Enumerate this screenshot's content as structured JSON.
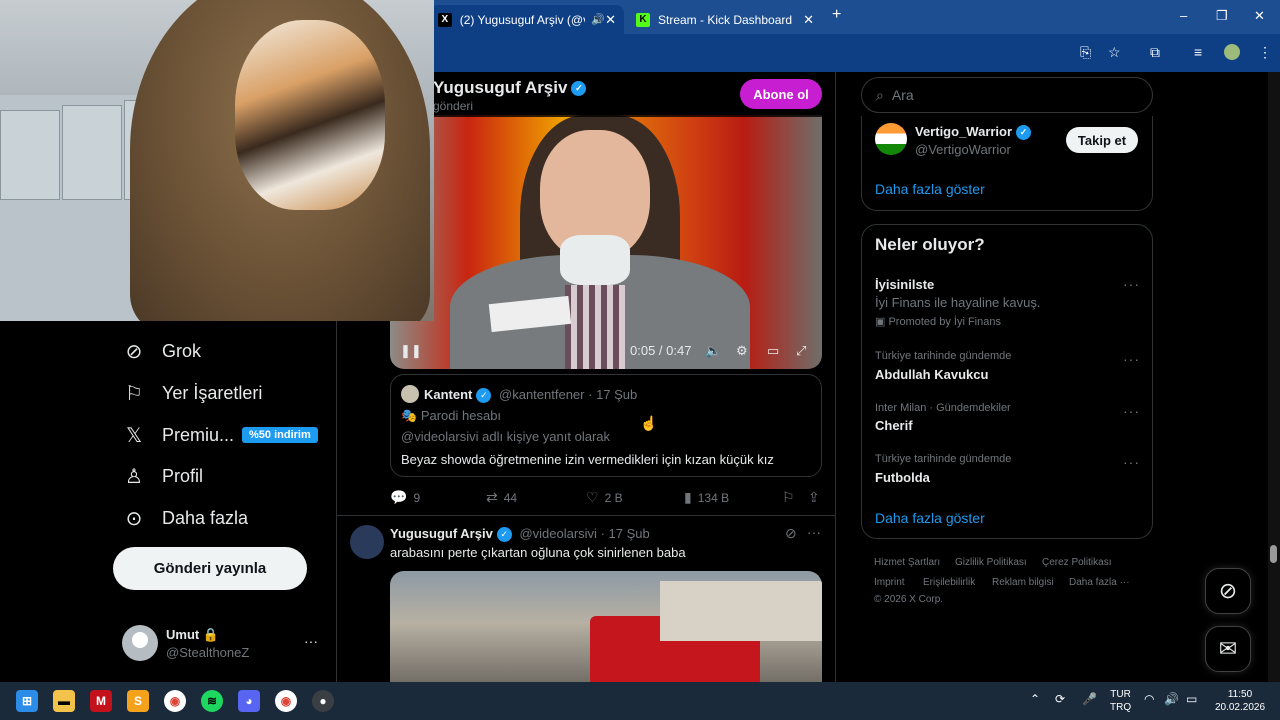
{
  "browser": {
    "tabs": [
      {
        "title": "(2) Yugusuguf Arşiv (@vide",
        "favicon": "X",
        "active": true
      },
      {
        "title": "Stream - Kick Dashboard",
        "favicon": "K",
        "active": false
      }
    ],
    "new_tab": "+",
    "close": "✕",
    "window_controls": [
      "–",
      "❐",
      "✕"
    ]
  },
  "nav": {
    "items": [
      {
        "label": "Grok",
        "icon": "grok-icon"
      },
      {
        "label": "Yer İşaretleri",
        "icon": "bookmark-icon"
      },
      {
        "label": "Premiu...",
        "icon": "x-logo-icon"
      },
      {
        "label": "Profil",
        "icon": "person-icon"
      },
      {
        "label": "Daha fazla",
        "icon": "more-circle-icon"
      }
    ],
    "premium_badge": "%50 indirim",
    "post_button": "Gönderi yayınla",
    "account": {
      "name": "Umut",
      "handle": "@StealthoneZ",
      "more": "···"
    }
  },
  "profile_header": {
    "name": "Yugusuguf Arşiv",
    "subtitle": "gönderi",
    "subscribe_button": "Abone ol"
  },
  "tweet1": {
    "video": {
      "time": "0:05 / 0:47"
    },
    "quote": {
      "author": "Kantent",
      "handle": "@kantentfener",
      "date": "· 17 Şub",
      "parody": "Parodi hesabı",
      "reply_to": "@videolarsivi adlı kişiye yanıt olarak",
      "text": "Beyaz showda öğretmenine izin vermedikleri için kızan küçük kız"
    },
    "actions": {
      "replies": "9",
      "retweets": "44",
      "likes": "2 B",
      "views": "134 B"
    }
  },
  "tweet2": {
    "author": "Yugusuguf Arşiv",
    "handle": "@videolarsivi",
    "date": "· 17 Şub",
    "text": "arabasını perte çıkartan oğluna çok sinirlenen baba"
  },
  "search": {
    "placeholder": "Ara"
  },
  "who_to_follow": {
    "name": "Vertigo_Warrior",
    "handle": "@VertigoWarrior",
    "follow_button": "Takip et",
    "show_more": "Daha fazla göster"
  },
  "trends": {
    "title": "Neler oluyor?",
    "promoted": {
      "name": "İyisinilste",
      "desc": "İyi Finans ile hayaline kavuş.",
      "label": "Promoted by İyi Finans"
    },
    "items": [
      {
        "meta": "Türkiye tarihinde gündemde",
        "name": "Abdullah Kavukcu"
      },
      {
        "meta": "Inter Milan · Gündemdekiler",
        "name": "Cherif"
      },
      {
        "meta": "Türkiye tarihinde gündemde",
        "name": "Futbolda"
      }
    ],
    "show_more": "Daha fazla göster"
  },
  "footer": {
    "links": [
      "Hizmet Şartları",
      "Gizlilik Politikası",
      "Çerez Politikası",
      "Imprint",
      "Erişilebilirlik",
      "Reklam bilgisi",
      "Daha fazla ···"
    ],
    "copyright": "© 2026 X Corp."
  },
  "taskbar": {
    "lang": "TUR",
    "lang2": "TRQ",
    "time": "11:50",
    "date": "20.02.2026"
  },
  "colors": {
    "accent": "#1d9bf0",
    "premium": "#c81ed1",
    "tabbar": "#1d4e92"
  }
}
